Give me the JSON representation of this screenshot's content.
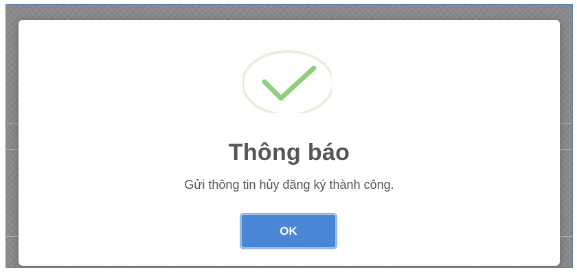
{
  "dialog": {
    "icon": "checkmark-circle-icon",
    "title": "Thông báo",
    "message": "Gửi thông tin hủy đăng ký thành công.",
    "ok_label": "OK"
  },
  "colors": {
    "check": "#8fce7a",
    "ring": "#e4f2dc",
    "button": "#4a86d6",
    "title": "#555555"
  }
}
